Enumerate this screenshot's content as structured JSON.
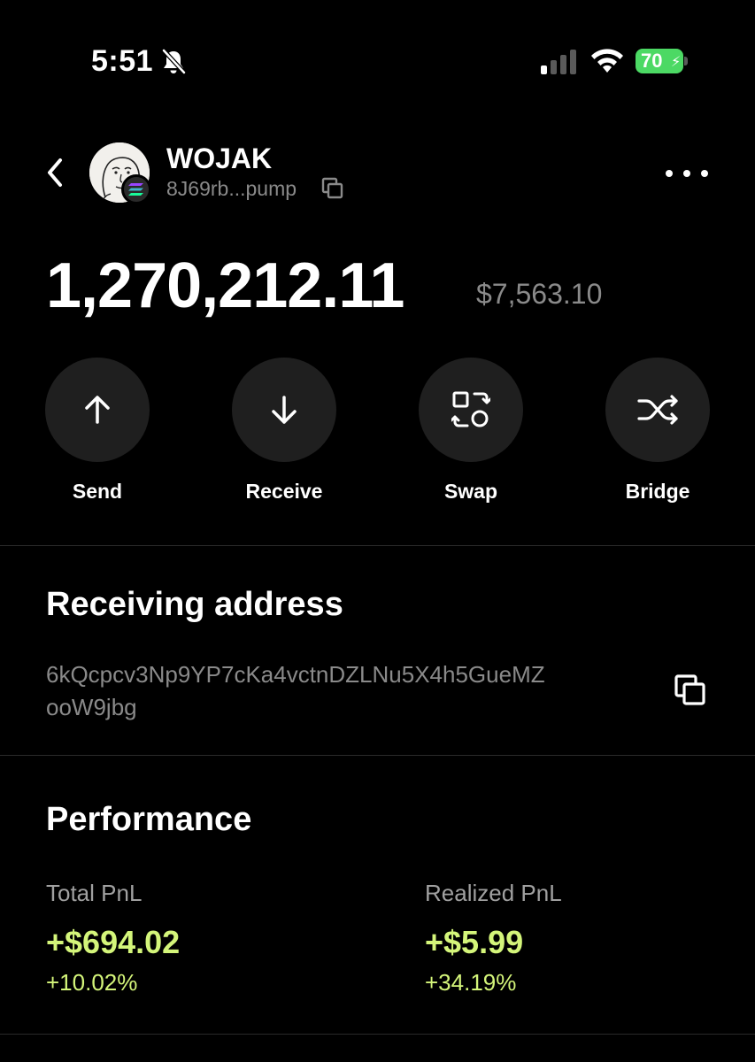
{
  "status_bar": {
    "time": "5:51",
    "battery_level": "70",
    "icons": [
      "bell-muted-icon",
      "signal-icon",
      "wifi-icon",
      "battery-charging-icon"
    ]
  },
  "header": {
    "token_name": "WOJAK",
    "token_address_short": "8J69rb...pump"
  },
  "balance": {
    "amount": "1,270,212.11",
    "usd_value": "$7,563.10"
  },
  "actions": [
    {
      "label": "Send",
      "icon": "arrow-up-icon"
    },
    {
      "label": "Receive",
      "icon": "arrow-down-icon"
    },
    {
      "label": "Swap",
      "icon": "swap-icon"
    },
    {
      "label": "Bridge",
      "icon": "bridge-icon"
    }
  ],
  "receiving": {
    "title": "Receiving address",
    "address_line1": "6kQcpcv3Np9YP7cKa4vctnDZLNu5X4h5GueMZ",
    "address_line2": "ooW9jbg"
  },
  "performance": {
    "title": "Performance",
    "total_pnl": {
      "label": "Total PnL",
      "value": "+$694.02",
      "percent": "+10.02%"
    },
    "realized_pnl": {
      "label": "Realized PnL",
      "value": "+$5.99",
      "percent": "+34.19%"
    }
  },
  "colors": {
    "background": "#000000",
    "positive": "#d4f57a",
    "muted_text": "#8a8a8a",
    "action_circle": "#1f1f1f",
    "battery": "#4cd964"
  }
}
